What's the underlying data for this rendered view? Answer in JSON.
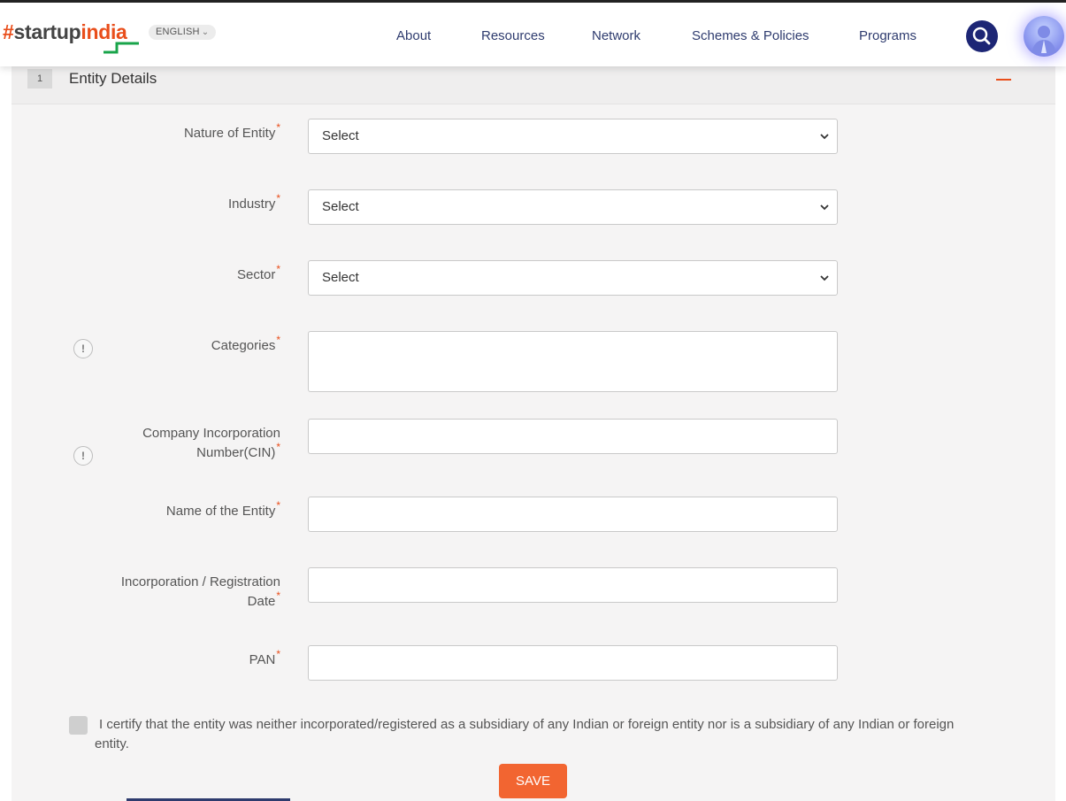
{
  "header": {
    "logo": {
      "hash": "#",
      "start": "startup",
      "india": "india"
    },
    "language": "ENGLISH",
    "nav": [
      "About",
      "Resources",
      "Network",
      "Schemes & Policies",
      "Programs"
    ],
    "accent_color": "#e94e1b",
    "nav_color": "#2e3b6e",
    "search_icon": "search-icon",
    "avatar_icon": "user-avatar"
  },
  "section": {
    "step": "1",
    "title": "Entity Details",
    "collapse_icon": "minus-icon"
  },
  "form": {
    "required_marker": "*",
    "nature_of_entity": {
      "label": "Nature of Entity",
      "value": "Select"
    },
    "industry": {
      "label": "Industry",
      "value": "Select"
    },
    "sector": {
      "label": "Sector",
      "value": "Select"
    },
    "categories": {
      "label": "Categories",
      "value": ""
    },
    "cin": {
      "label_line1": "Company Incorporation",
      "label_line2": "Number(CIN)",
      "value": ""
    },
    "entity_name": {
      "label": "Name of the Entity",
      "value": ""
    },
    "registration_date": {
      "label_line1": "Incorporation / Registration",
      "label_line2": "Date",
      "value": ""
    },
    "pan": {
      "label": "PAN",
      "value": ""
    },
    "info_glyph": "!",
    "certify_text": "I certify that the entity was neither incorporated/registered as a subsidiary of any Indian or foreign entity nor is a subsidiary of any Indian or foreign entity.",
    "save_label": "SAVE",
    "save_color": "#f26531"
  }
}
